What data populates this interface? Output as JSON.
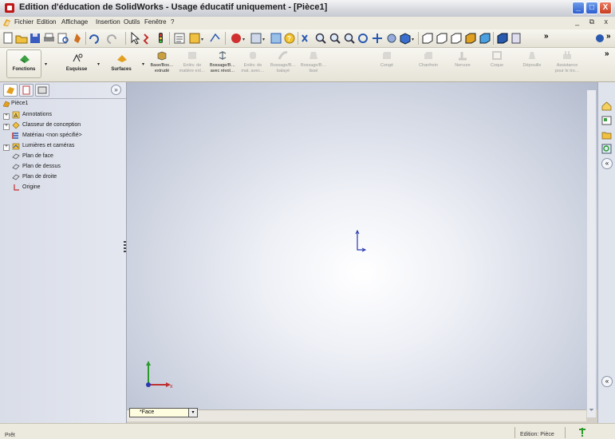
{
  "window": {
    "title": "Edition d'éducation de SolidWorks - Usage éducatif uniquement - [Pièce1]",
    "controls": [
      "_",
      "□",
      "X"
    ]
  },
  "menu": {
    "items": [
      "Fichier",
      "Edition",
      "Affichage",
      "Insertion",
      "Outils",
      "Fenêtre",
      "?"
    ],
    "doc_controls": "_ ⧉ x"
  },
  "toolbar": {
    "icons": [
      "new-document-icon",
      "open-icon",
      "save-icon",
      "print-icon",
      "print-preview-icon",
      "options-icon",
      "undo-icon",
      "redo-icon",
      "select-icon",
      "rebuild-icon",
      "traffic-light-icon",
      "file-properties-icon",
      "options-view-icon",
      "smart-dimension-icon",
      "appearance-icon",
      "section-view-icon",
      "view-orientation-icon",
      "help-icon",
      "zoom-to-fit-icon",
      "zoom-area-icon",
      "zoom-in-out-icon",
      "zoom-selection-icon",
      "rotate-icon",
      "pan-icon",
      "view-icon",
      "display-style-icon",
      "standard-views-icon",
      "shaded-icon",
      "hidden-lines-icon",
      "wireframe-icon",
      "shaded-edges-icon",
      "perspective-icon",
      "more-icon"
    ],
    "overflow": "»"
  },
  "command_manager": {
    "tabs": [
      {
        "label": "Fonctions",
        "icon": "features-icon"
      },
      {
        "label": "Esquisse",
        "icon": "sketch-icon"
      },
      {
        "label": "Surfaces",
        "icon": "surfaces-icon"
      }
    ],
    "tools": [
      {
        "label1": "Base/Bos…",
        "label2": "extrudé",
        "enabled": true,
        "icon": "extruded-boss-icon"
      },
      {
        "label1": "Enlèv. de",
        "label2": "matière ext…",
        "enabled": false,
        "icon": "extruded-cut-icon"
      },
      {
        "label1": "Bossage/B…",
        "label2": "avec révol…",
        "enabled": true,
        "icon": "revolved-boss-icon"
      },
      {
        "label1": "Enlèv. de",
        "label2": "mat. avec…",
        "enabled": false,
        "icon": "revolved-cut-icon"
      },
      {
        "label1": "Bossage/B…",
        "label2": "balayé",
        "enabled": false,
        "icon": "swept-boss-icon"
      },
      {
        "label1": "Bossage/B…",
        "label2": "lissé",
        "enabled": false,
        "icon": "lofted-boss-icon"
      },
      {
        "label1": "Congé",
        "label2": "",
        "enabled": false,
        "icon": "fillet-icon"
      },
      {
        "label1": "Chanfrein",
        "label2": "",
        "enabled": false,
        "icon": "chamfer-icon"
      },
      {
        "label1": "Nervure",
        "label2": "",
        "enabled": false,
        "icon": "rib-icon"
      },
      {
        "label1": "Coque",
        "label2": "",
        "enabled": false,
        "icon": "shell-icon"
      },
      {
        "label1": "Dépouille",
        "label2": "",
        "enabled": false,
        "icon": "draft-icon"
      },
      {
        "label1": "Assistance",
        "label2": "pour le tro…",
        "enabled": false,
        "icon": "hole-wizard-icon"
      }
    ],
    "overflow": "»"
  },
  "feature_tree": {
    "tabs": [
      "featuremanager-tab-icon",
      "propertymanager-tab-icon",
      "configurationmanager-tab-icon"
    ],
    "expand": "»",
    "root": "Pièce1",
    "items": [
      {
        "label": "Annotations",
        "icon": "annotations-icon",
        "expandable": true
      },
      {
        "label": "Classeur de conception",
        "icon": "design-binder-icon",
        "expandable": true
      },
      {
        "label": "Matériau <non spécifié>",
        "icon": "material-icon",
        "expandable": false
      },
      {
        "label": "Lumières et caméras",
        "icon": "lights-cameras-icon",
        "expandable": true
      },
      {
        "label": "Plan de face",
        "icon": "plane-icon",
        "expandable": false
      },
      {
        "label": "Plan de dessus",
        "icon": "plane-icon",
        "expandable": false
      },
      {
        "label": "Plan de droite",
        "icon": "plane-icon",
        "expandable": false
      },
      {
        "label": "Origine",
        "icon": "origin-icon",
        "expandable": false
      }
    ]
  },
  "viewport": {
    "view_name": "*Face",
    "view_dropdown_arrow": "▾"
  },
  "task_pane": {
    "icons": [
      "home-icon",
      "design-library-icon",
      "file-explorer-icon",
      "search-icon",
      "collapse-icon",
      "expand-icon"
    ],
    "collapse_glyph": "«"
  },
  "status": {
    "message": "Prêt",
    "mode": "Edition: Pièce",
    "help_icon": "help-icon"
  },
  "colors": {
    "titlebar_accent": "#c01818",
    "viewport_center": "#ffffff",
    "viewport_edge": "#b2bacc",
    "triad_x": "#c03030",
    "triad_y": "#2a9a2a",
    "triad_z": "#2a3ab0"
  }
}
